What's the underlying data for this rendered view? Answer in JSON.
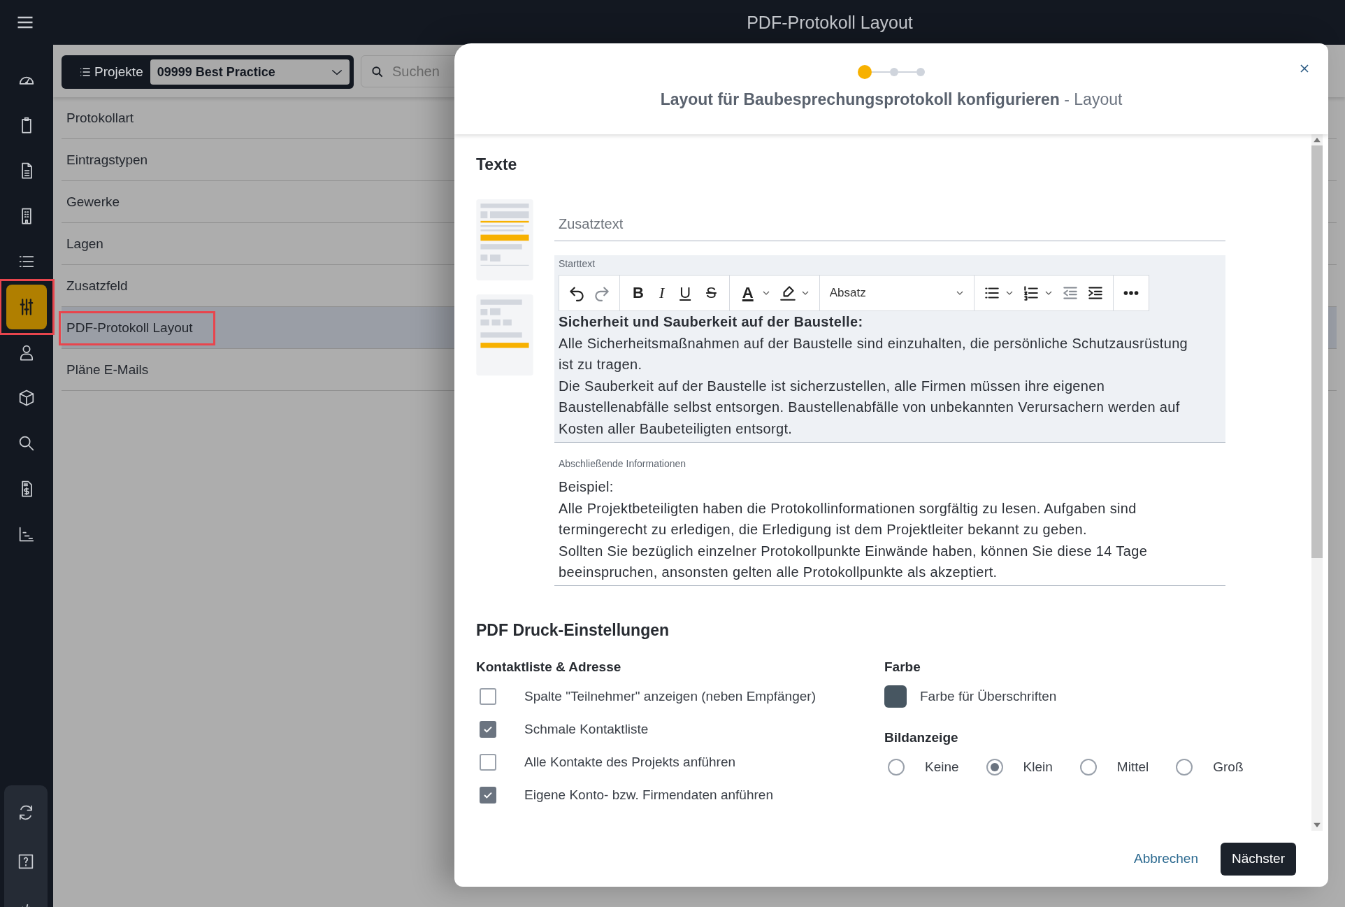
{
  "app_title": "PDF-Protokoll Layout",
  "nav": [
    {
      "selected": false,
      "highlighted": false
    },
    {
      "selected": false,
      "highlighted": false
    },
    {
      "selected": false,
      "highlighted": false
    },
    {
      "selected": false,
      "highlighted": false
    },
    {
      "selected": false,
      "highlighted": false
    },
    {
      "selected": true,
      "highlighted": true
    },
    {
      "selected": false,
      "highlighted": false
    },
    {
      "selected": false,
      "highlighted": false
    },
    {
      "selected": false,
      "highlighted": false
    },
    {
      "selected": false,
      "highlighted": false
    },
    {
      "selected": false,
      "highlighted": false
    }
  ],
  "nav_bottom": [
    {
      "selected": false
    },
    {
      "selected": false
    },
    {
      "selected": false
    }
  ],
  "project_bar": {
    "label": "Projekte",
    "project": "09999 Best Practice",
    "search_placeholder": "Suchen"
  },
  "menu": [
    {
      "label": "Protokollart",
      "selected": false,
      "highlighted": false
    },
    {
      "label": "Eintragstypen",
      "selected": false,
      "highlighted": false
    },
    {
      "label": "Gewerke",
      "selected": false,
      "highlighted": false
    },
    {
      "label": "Lagen",
      "selected": false,
      "highlighted": false
    },
    {
      "label": "Zusatzfeld",
      "selected": false,
      "highlighted": false
    },
    {
      "label": "PDF-Protokoll Layout",
      "selected": true,
      "highlighted": true
    },
    {
      "label": "Pläne E-Mails",
      "selected": false,
      "highlighted": false
    }
  ],
  "dialog": {
    "steps": [
      {
        "selected": true
      },
      {
        "selected": false
      },
      {
        "selected": false
      }
    ],
    "title": "**Layout für Baubesprechungsprotokoll konfigurieren** - Layout",
    "texts_heading": "Texte",
    "extra_text": {
      "placeholder": "Zusatztext"
    },
    "start_text": {
      "label": "Starttext",
      "toolbar": {
        "format_buttons": [
          "B",
          "I",
          "U",
          "S"
        ],
        "font_color_glyph": "A",
        "block_format": "Absatz"
      },
      "paragraphs": [
        {
          "text": "Sicherheit und Sauberkeit auf der Baustelle:",
          "bold": true
        },
        {
          "text": "Alle Sicherheitsmaßnahmen auf der Baustelle sind einzuhalten, die persönliche Schutzausrüstung ist zu tragen.",
          "bold": false
        },
        {
          "text": "Die Sauberkeit auf der Baustelle ist sicherzustellen, alle Firmen müssen ihre eigenen Baustellenabfälle selbst entsorgen. Baustellenabfälle von unbekannten Verursachern werden auf Kosten aller Baubeteiligten entsorgt.",
          "bold": false
        }
      ]
    },
    "closing_text": {
      "label": "Abschließende Informationen",
      "paragraphs": [
        {
          "text": "Beispiel:",
          "bold": false
        },
        {
          "text": "Alle Projektbeteiligten haben die Protokollinformationen sorgfältig zu lesen. Aufgaben sind termingerecht zu erledigen, die Erledigung ist dem Projektleiter bekannt zu geben.",
          "bold": false
        },
        {
          "text": "Sollten Sie bezüglich einzelner Protokollpunkte Einwände haben, können Sie diese 14 Tage beeinspruchen, ansonsten gelten alle Protokollpunkte als akzeptiert.",
          "bold": false
        }
      ]
    },
    "print_heading": "PDF Druck-Einstellungen",
    "contacts": {
      "heading": "Kontaktliste & Adresse",
      "options": [
        {
          "label": "Spalte \"Teilnehmer\" anzeigen (neben Empfänger)",
          "checked": false
        },
        {
          "label": "Schmale Kontaktliste",
          "checked": true
        },
        {
          "label": "Alle Kontakte des Projekts anführen",
          "checked": false
        },
        {
          "label": "Eigene Konto- bzw. Firmendaten anführen",
          "checked": true
        }
      ]
    },
    "color": {
      "heading": "Farbe",
      "label": "Farbe für Überschriften",
      "color": "#475661"
    },
    "images": {
      "heading": "Bildanzeige",
      "options": [
        {
          "label": "Keine",
          "selected": false
        },
        {
          "label": "Klein",
          "selected": true
        },
        {
          "label": "Mittel",
          "selected": false
        },
        {
          "label": "Groß",
          "selected": false
        }
      ]
    },
    "cancel": "Abbrechen",
    "next": "Nächster"
  }
}
